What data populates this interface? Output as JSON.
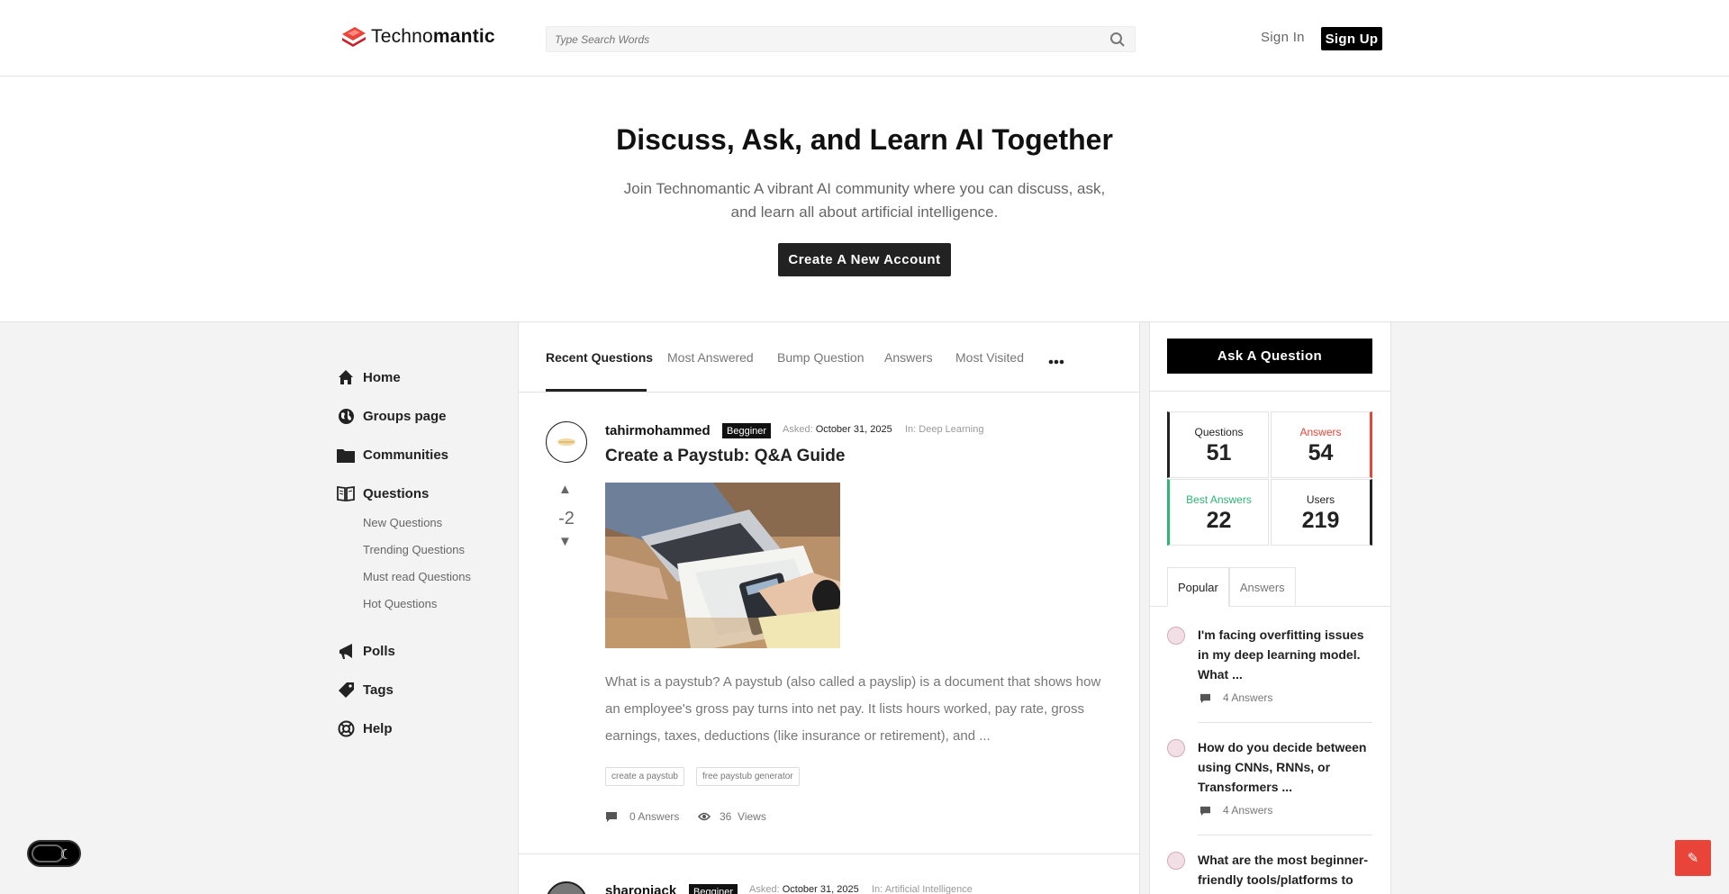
{
  "header": {
    "logo_light": "Techno",
    "logo_bold": "mantic",
    "search_placeholder": "Type Search Words",
    "signin_label": "Sign In",
    "signup_label": "Sign Up"
  },
  "hero": {
    "title": "Discuss, Ask, and Learn AI Together",
    "subtitle": "Join Technomantic A vibrant AI community where you can discuss, ask, and learn all about artificial intelligence.",
    "button_label": "Create A New Account"
  },
  "sidebar": {
    "items": [
      {
        "label": "Home",
        "icon": "home-icon"
      },
      {
        "label": "Groups page",
        "icon": "globe-icon"
      },
      {
        "label": "Communities",
        "icon": "folder-icon"
      },
      {
        "label": "Questions",
        "icon": "book-icon"
      },
      {
        "label": "Polls",
        "icon": "megaphone-icon"
      },
      {
        "label": "Tags",
        "icon": "tag-icon"
      },
      {
        "label": "Help",
        "icon": "lifebuoy-icon"
      }
    ],
    "sub_items": [
      "New Questions",
      "Trending Questions",
      "Must read Questions",
      "Hot Questions"
    ]
  },
  "main": {
    "tabs": [
      "Recent Questions",
      "Most Answered",
      "Bump Question",
      "Answers",
      "Most Visited"
    ],
    "active_tab": "Recent Questions",
    "question": {
      "author": "tahirmohammed",
      "badge": "Begginer",
      "asked_label": "Asked:",
      "asked_date": "October 31, 2025",
      "in_label": "In:",
      "category": "Deep Learning",
      "title": "Create a Paystub: Q&A Guide",
      "votes": "-2",
      "excerpt": "What is a paystub? A paystub (also called a payslip) is a document that shows how an employee's gross pay turns into net pay. It lists hours worked, pay rate, gross earnings, taxes, deductions (like insurance or retirement), and ...",
      "tags": [
        "create a paystub",
        "free paystub generator"
      ],
      "answers": "0 Answers",
      "views_count": "36",
      "views_label": "Views"
    },
    "question2": {
      "author": "sharonjack",
      "badge": "Begginer",
      "asked_label": "Asked:",
      "asked_date": "October 31, 2025",
      "in_label": "In:",
      "category": "Artificial Intelligence"
    }
  },
  "right": {
    "ask_label": "Ask A Question",
    "stats": [
      {
        "label": "Questions",
        "value": "51",
        "accent": "#222222",
        "label_color": "#222222"
      },
      {
        "label": "Answers",
        "value": "54",
        "accent": "#e8443a",
        "label_color": "#e8443a"
      },
      {
        "label": "Best Answers",
        "value": "22",
        "accent": "#2bb673",
        "label_color": "#2bb673"
      },
      {
        "label": "Users",
        "value": "219",
        "accent": "#222222",
        "label_color": "#222222"
      }
    ],
    "tabs": [
      "Popular",
      "Answers"
    ],
    "popular": [
      {
        "title": "I'm facing overfitting issues in my deep learning model. What ...",
        "answers": "4 Answers"
      },
      {
        "title": "How do you decide between using CNNs, RNNs, or Transformers ...",
        "answers": "4 Answers"
      },
      {
        "title": "What are the most beginner-friendly tools/platforms to",
        "answers": ""
      }
    ]
  },
  "colors": {
    "accent_red": "#e8443a",
    "accent_green": "#2bb673",
    "dark": "#111111"
  }
}
